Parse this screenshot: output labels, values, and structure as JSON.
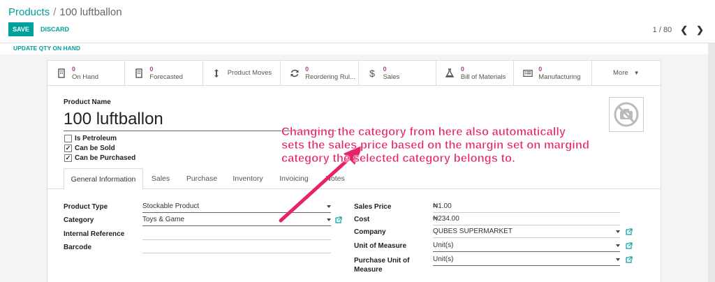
{
  "breadcrumb": {
    "root": "Products",
    "separator": "/",
    "current": "100 luftballon"
  },
  "toolbar": {
    "save_label": "SAVE",
    "discard_label": "DISCARD"
  },
  "pager": {
    "value": "1 / 80"
  },
  "actions": {
    "update_qty": "UPDATE QTY ON HAND"
  },
  "smart_buttons": [
    {
      "icon": "building-icon",
      "value": "0",
      "label": "On Hand"
    },
    {
      "icon": "building-icon",
      "value": "0",
      "label": "Forecasted"
    },
    {
      "icon": "vertical-arrows-icon",
      "label": "Product Moves"
    },
    {
      "icon": "refresh-icon",
      "value": "0",
      "label": "Reordering Rul..."
    },
    {
      "icon": "dollar-icon",
      "value": "0",
      "label": "Sales"
    },
    {
      "icon": "flask-icon",
      "value": "0",
      "label": "Bill of Materials"
    },
    {
      "icon": "list-icon",
      "value": "0",
      "label": "Manufacturing"
    },
    {
      "label": "More"
    }
  ],
  "product": {
    "name_label": "Product Name",
    "name": "100 luftballon",
    "checkboxes": [
      {
        "label": "Is Petroleum",
        "checked": false
      },
      {
        "label": "Can be Sold",
        "checked": true
      },
      {
        "label": "Can be Purchased",
        "checked": true
      }
    ]
  },
  "tabs": [
    "General Information",
    "Sales",
    "Purchase",
    "Inventory",
    "Invoicing",
    "Notes"
  ],
  "left_fields": {
    "product_type": {
      "label": "Product Type",
      "value": "Stockable Product"
    },
    "category": {
      "label": "Category",
      "value": "Toys & Game"
    },
    "internal_ref": {
      "label": "Internal Reference",
      "value": ""
    },
    "barcode": {
      "label": "Barcode",
      "value": ""
    }
  },
  "right_fields": {
    "sales_price": {
      "label": "Sales Price",
      "value": "₦1.00"
    },
    "cost": {
      "label": "Cost",
      "value": "₦234.00"
    },
    "company": {
      "label": "Company",
      "value": "QUBES SUPERMARKET"
    },
    "uom": {
      "label": "Unit of Measure",
      "value": "Unit(s)"
    },
    "purchase_uom": {
      "label_line1": "Purchase Unit of",
      "label_line2": "Measure",
      "value": "Unit(s)"
    }
  },
  "annotation": {
    "line1": "Changing the category from here also automatically",
    "line2": "sets the sales price based on the margin set on margind",
    "line3": "category the selected category belongs to.",
    "color": "#e8226a"
  },
  "colors": {
    "accent": "#00a09d",
    "smart_value": "#a24689"
  }
}
